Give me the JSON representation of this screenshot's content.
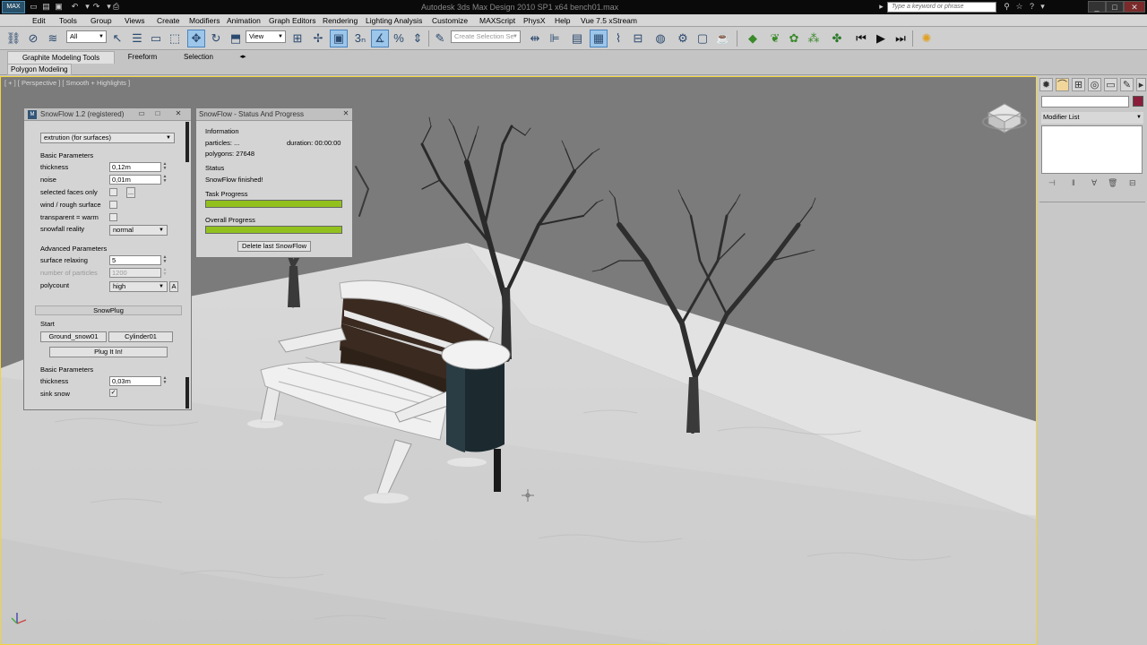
{
  "titlebar": {
    "app_icon": "MAX",
    "title": "Autodesk 3ds Max Design 2010 SP1 x64   bench01.max",
    "search_placeholder": "Type a keyword or phrase",
    "icons": [
      "binoculars-icon",
      "star-icon",
      "help-icon"
    ],
    "window_buttons": [
      "_",
      "□",
      "✕"
    ]
  },
  "menu": [
    "Edit",
    "Tools",
    "Group",
    "Views",
    "Create",
    "Modifiers",
    "Animation",
    "Graph Editors",
    "Rendering",
    "Lighting Analysis",
    "Customize",
    "MAXScript",
    "PhysX",
    "Help",
    "Vue 7.5 xStream"
  ],
  "toolbar": {
    "filter_label": "All",
    "refcoord_label": "View",
    "selection_set_placeholder": "Create Selection Se"
  },
  "ribbon": {
    "tabs": [
      "Graphite Modeling Tools",
      "Freeform",
      "Selection"
    ],
    "sub_label": "Polygon Modeling"
  },
  "viewport": {
    "label": "[ + ] [ Perspective ] [ Smooth + Highlights ]"
  },
  "command_panel": {
    "modifier_list_label": "Modifier List",
    "accent_color": "#8a1e3a"
  },
  "snowflow": {
    "title": "SnowFlow 1.2 (registered)",
    "mode": "extrution    (for surfaces)",
    "basic_title": "Basic Parameters",
    "thickness_label": "thickness",
    "thickness": "0,12m",
    "noise_label": "noise",
    "noise": "0,01m",
    "selected_faces_label": "selected faces only",
    "wind_label": "wind / rough surface",
    "transparent_label": "transparent = warm",
    "reality_label": "snowfall reality",
    "reality": "normal",
    "advanced_title": "Advanced Parameters",
    "relaxing_label": "surface relaxing",
    "relaxing": "5",
    "particles_label": "number of particles",
    "particles": "1200",
    "polycount_label": "polycount",
    "polycount": "high",
    "a_button": "A",
    "ellipsis_button": "..."
  },
  "snowplug": {
    "rollout": "SnowPlug",
    "start_title": "Start",
    "object1": "Ground_snow01",
    "object2": "Cylinder01",
    "plug_button": "Plug It In!",
    "basic_title": "Basic Parameters",
    "thickness_label": "thickness",
    "thickness": "0,03m",
    "sink_label": "sink snow",
    "sink_checked": "✓"
  },
  "status": {
    "title": "SnowFlow - Status And Progress",
    "info_title": "Information",
    "particles": "particles: ...",
    "duration": "duration: 00:00:00",
    "polygons": "polygons: 27648",
    "status_title": "Status",
    "status_text": "SnowFlow finished!",
    "task_title": "Task Progress",
    "task_progress": 1.0,
    "overall_title": "Overall Progress",
    "overall_progress": 1.0,
    "delete_button": "Delete last SnowFlow",
    "close": "✕",
    "bar_color": "#92c11e"
  }
}
